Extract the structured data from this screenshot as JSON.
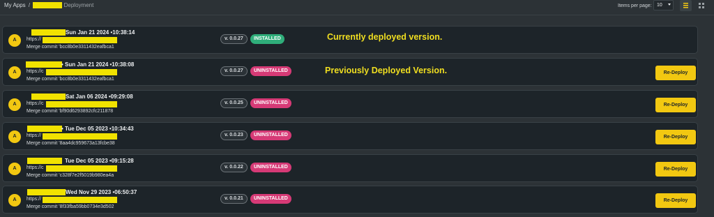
{
  "breadcrumb": {
    "root": "My Apps",
    "separator": "/",
    "current": "Deployment"
  },
  "pagination": {
    "items_per_page_label": "Items per page:",
    "items_per_page_value": "10"
  },
  "view_toggle": {
    "active": "list",
    "list_icon": "list-icon",
    "grid_icon": "grid-icon"
  },
  "colors": {
    "accent": "#f2c811",
    "installed": "#2fae7a",
    "uninstalled": "#d63a76",
    "redaction": "#f1e200"
  },
  "annotations": {
    "current": "Currently deployed version.",
    "previous": "Previously Deployed Version."
  },
  "deployments": [
    {
      "avatar": "A",
      "timestamp": "Sun Jan 21 2024 •10:38:14",
      "url": "https://",
      "commit": "Merge commit 'bcc8b0e3311432eafbca1",
      "version": "v. 0.0.27",
      "status": "INSTALLED",
      "action": ""
    },
    {
      "avatar": "A",
      "timestamp": "• Sun Jan 21 2024 •10:38:08",
      "url": "https://c",
      "commit": "Merge commit 'bcc8b0e3311432eafbca1",
      "version": "v. 0.0.27",
      "status": "UNINSTALLED",
      "action": "Re-Deploy"
    },
    {
      "avatar": "A",
      "timestamp": "Sat Jan 06 2024 •09:29:08",
      "url": "https://c",
      "commit": "Merge commit 'bf90d6293892cfc211878",
      "version": "v. 0.0.25",
      "status": "UNINSTALLED",
      "action": "Re-Deploy"
    },
    {
      "avatar": "A",
      "timestamp": "• Tue Dec 05 2023 •10:34:43",
      "url": "https://",
      "commit": "Merge commit '8aa4dc959673a13fcbe38",
      "version": "v. 0.0.23",
      "status": "UNINSTALLED",
      "action": "Re-Deploy"
    },
    {
      "avatar": "A",
      "timestamp": "Tue Dec 05 2023 •09:15:28",
      "url": "https://c",
      "commit": "Merge commit 'c328f7e2f5019b980ea4a",
      "version": "v. 0.0.22",
      "status": "UNINSTALLED",
      "action": "Re-Deploy"
    },
    {
      "avatar": "A",
      "timestamp": "Wed Nov 29 2023 •06:50:37",
      "url": "https://",
      "commit": "Merge commit '8f33fba59bb0734e3d502",
      "version": "v. 0.0.21",
      "status": "UNINSTALLED",
      "action": "Re-Deploy"
    }
  ]
}
